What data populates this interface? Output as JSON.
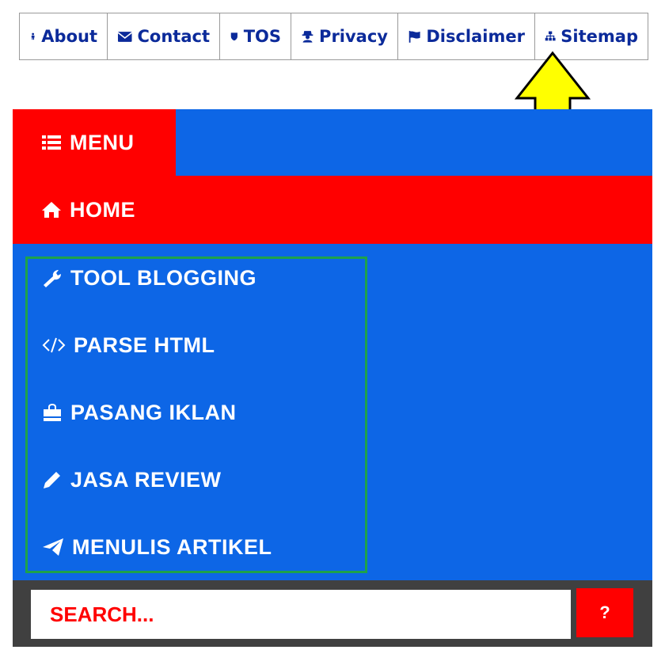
{
  "top_links": [
    {
      "label": "About",
      "icon": "person-icon"
    },
    {
      "label": "Contact",
      "icon": "envelope-icon"
    },
    {
      "label": "TOS",
      "icon": "shield-icon"
    },
    {
      "label": "Privacy",
      "icon": "user-secret-icon"
    },
    {
      "label": "Disclaimer",
      "icon": "flag-icon"
    },
    {
      "label": "Sitemap",
      "icon": "sitemap-icon"
    }
  ],
  "menu": {
    "toggle_label": "MENU",
    "home_label": "HOME",
    "items": [
      {
        "label": "TOOL BLOGGING",
        "icon": "wrench-icon"
      },
      {
        "label": "PARSE HTML",
        "icon": "code-icon"
      },
      {
        "label": "PASANG IKLAN",
        "icon": "shopping-bag-icon"
      },
      {
        "label": "JASA REVIEW",
        "icon": "pencil-icon"
      },
      {
        "label": "MENULIS ARTIKEL",
        "icon": "paper-plane-icon"
      }
    ]
  },
  "search": {
    "placeholder": "SEARCH...",
    "button_label": "?"
  },
  "colors": {
    "menu_blue": "#0d66e6",
    "menu_red": "#ff0000",
    "search_bar_bg": "#404040",
    "link_text": "#0b2a9a",
    "highlight_border": "#1ea24a",
    "arrow_fill": "#ffff00"
  }
}
